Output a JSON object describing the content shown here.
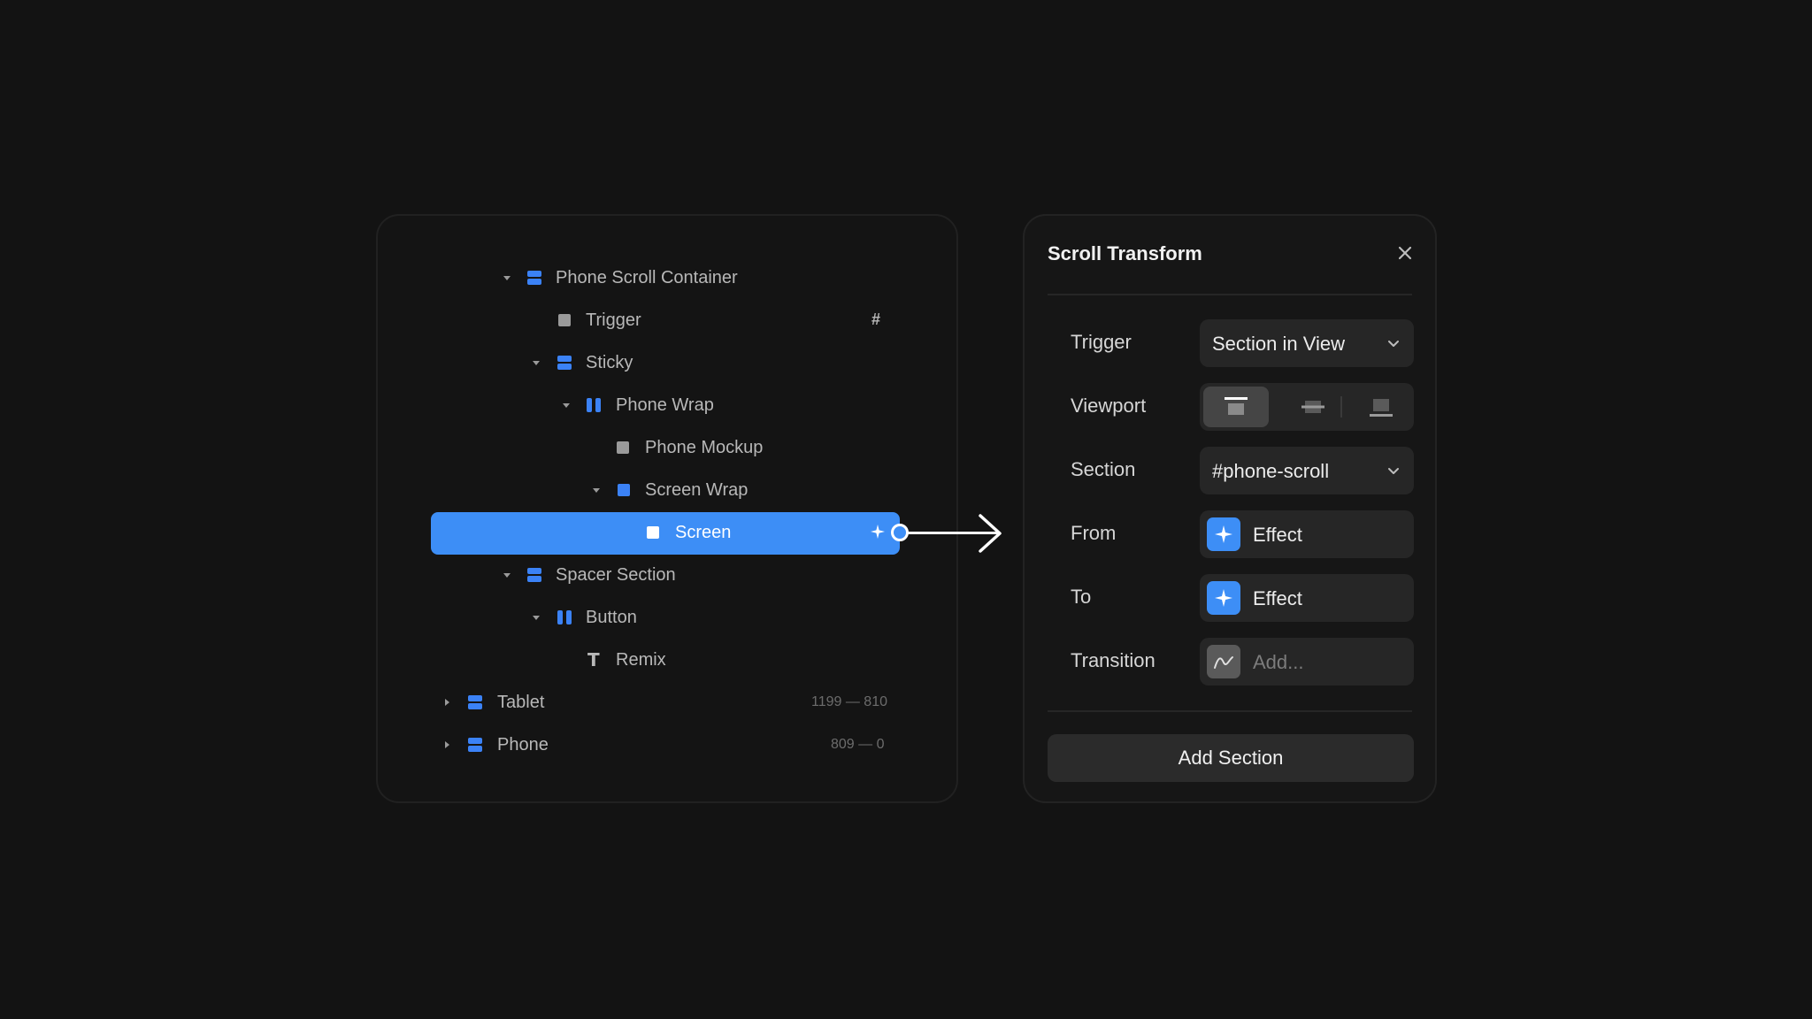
{
  "layers": {
    "items": [
      {
        "label": "Phone Scroll Container",
        "meta": ""
      },
      {
        "label": "Trigger",
        "meta": "#"
      },
      {
        "label": "Sticky",
        "meta": ""
      },
      {
        "label": "Phone Wrap",
        "meta": ""
      },
      {
        "label": "Phone Mockup",
        "meta": ""
      },
      {
        "label": "Screen Wrap",
        "meta": ""
      },
      {
        "label": "Screen",
        "meta": ""
      },
      {
        "label": "Spacer Section",
        "meta": ""
      },
      {
        "label": "Button",
        "meta": ""
      },
      {
        "label": "Remix",
        "meta": ""
      },
      {
        "label": "Tablet",
        "meta": "1199 — 810"
      },
      {
        "label": "Phone",
        "meta": "809 — 0"
      }
    ],
    "selected": "Screen"
  },
  "scroll_transform": {
    "title": "Scroll Transform",
    "close_icon": "close-icon",
    "trigger": {
      "label": "Trigger",
      "value": "Section in View"
    },
    "viewport": {
      "label": "Viewport",
      "options": [
        "top",
        "center",
        "bottom"
      ],
      "selected": "top"
    },
    "section": {
      "label": "Section",
      "value": "#phone-scroll"
    },
    "from": {
      "label": "From",
      "value": "Effect",
      "icon": "sparkle-icon"
    },
    "to": {
      "label": "To",
      "value": "Effect",
      "icon": "sparkle-icon"
    },
    "transition": {
      "label": "Transition",
      "placeholder": "Add...",
      "icon": "curve-icon"
    },
    "add_section_label": "Add Section"
  },
  "colors": {
    "accent": "#3d8ef6",
    "background": "#131313",
    "panel": "#161616",
    "control": "#262626"
  }
}
